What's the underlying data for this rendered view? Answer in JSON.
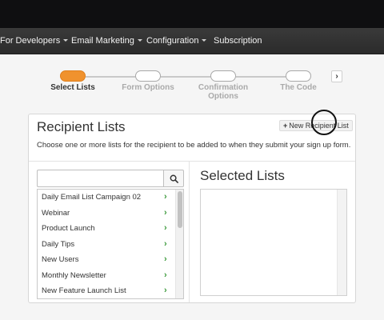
{
  "nav": {
    "items": [
      "For Developers",
      "Email Marketing",
      "Configuration",
      "Subscription"
    ]
  },
  "wizard": {
    "steps": [
      "Select Lists",
      "Form Options",
      "Confirmation Options",
      "The Code"
    ],
    "step_lines": [
      [
        "Confirmation"
      ],
      [
        "Options"
      ]
    ],
    "active_index": 0,
    "next_icon": "chevron-right-icon",
    "active_color": "#f0922e"
  },
  "panel": {
    "title": "Recipient Lists",
    "description": "Choose one or more lists for the recipient to be added to when they submit your sign up form.",
    "new_list_label": "New Recipient List",
    "search": {
      "value": "",
      "icon": "search-icon"
    },
    "lists": [
      "Daily Email List Campaign 02",
      "Webinar",
      "Product Launch",
      "Daily Tips",
      "New Users",
      "Monthly Newsletter",
      "New Feature Launch List"
    ],
    "selected_title": "Selected Lists",
    "chevron_color": "#3c9a3c"
  }
}
